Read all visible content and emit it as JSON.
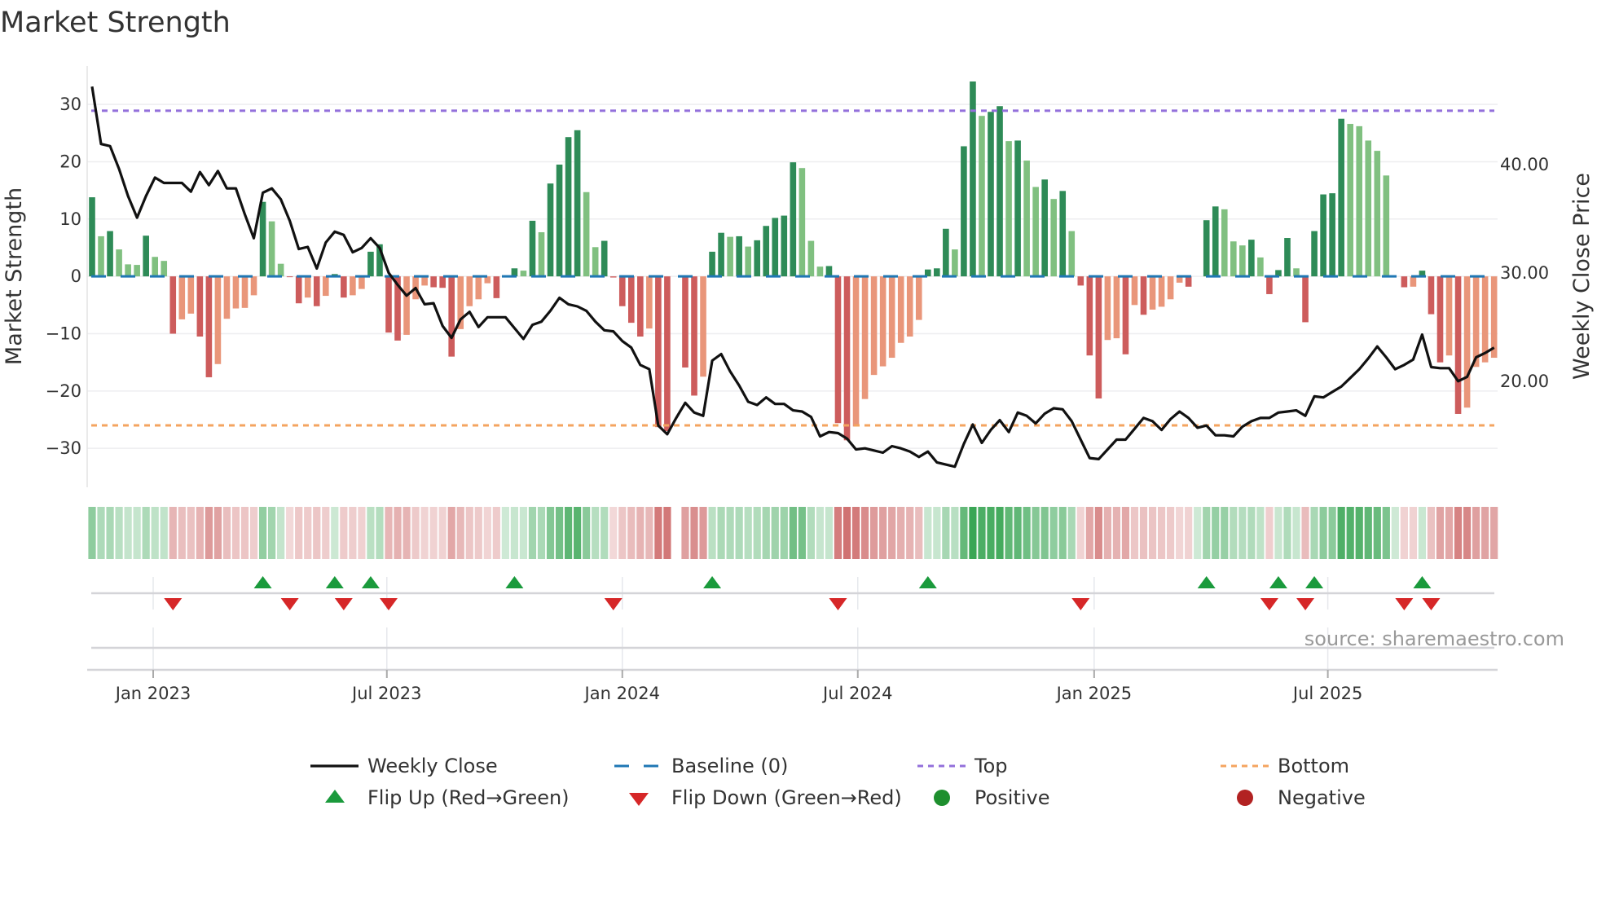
{
  "title": "Market Strength",
  "source": "source: sharemaestro.com",
  "colors": {
    "bar_pos_up": "#2e8b57",
    "bar_pos_down": "#80c080",
    "bar_neg_down": "#cd5c5c",
    "bar_neg_up": "#e9967a",
    "price": "#111111",
    "baseline": "#1f77b4",
    "top": "#9370db",
    "bottom": "#f4a460",
    "flip_up": "#1a9a3c",
    "flip_down": "#d62728",
    "positive": "#1e8f2e",
    "negative": "#b22222"
  },
  "chart_data": {
    "type": "bar+line",
    "title": "Market Strength",
    "ylabel": "Market Strength",
    "y2label": "Weekly Close Price",
    "ylim": [
      -36.8,
      36.7
    ],
    "y2lim": [
      10.2,
      49.1
    ],
    "yticks": [
      {
        "v": 30,
        "label": "30"
      },
      {
        "v": 20,
        "label": "20"
      },
      {
        "v": 10,
        "label": "10"
      },
      {
        "v": 0,
        "label": "0"
      },
      {
        "v": -10,
        "label": "−10"
      },
      {
        "v": -20,
        "label": "−20"
      },
      {
        "v": -30,
        "label": "−30"
      }
    ],
    "y2ticks": [
      {
        "v": 40,
        "label": "40.00"
      },
      {
        "v": 30,
        "label": "30.00"
      },
      {
        "v": 20,
        "label": "20.00"
      }
    ],
    "xticks": [
      {
        "week": 6.8,
        "label": "Jan 2023"
      },
      {
        "week": 32.8,
        "label": "Jul 2023"
      },
      {
        "week": 59.0,
        "label": "Jan 2024"
      },
      {
        "week": 85.2,
        "label": "Jul 2024"
      },
      {
        "week": 111.5,
        "label": "Jan 2025"
      },
      {
        "week": 137.5,
        "label": "Jul 2025"
      }
    ],
    "top": 28.9,
    "bottom": -26.0,
    "baseline": 0,
    "strength": [
      13.8,
      7,
      7.9,
      4.7,
      2.1,
      2,
      7.1,
      3.4,
      2.7,
      -10,
      -7.5,
      -6.5,
      -10.5,
      -17.6,
      -15.3,
      -7.4,
      -5.6,
      -5.5,
      -3.3,
      13,
      9.6,
      2.2,
      -0.1,
      -4.7,
      -3.7,
      -5.2,
      -3.4,
      0.4,
      -3.7,
      -3.3,
      -2.2,
      4.3,
      5.6,
      -9.8,
      -11.2,
      -10.2,
      -4,
      -1.6,
      -1.9,
      -2,
      -14,
      -9.2,
      -5.2,
      -4,
      -1.2,
      -3.8,
      0,
      1.4,
      1,
      9.7,
      7.7,
      16.2,
      19.5,
      24.3,
      25.5,
      14.7,
      5.1,
      6.2,
      -0.2,
      -5.2,
      -8.1,
      -10.5,
      -9.1,
      -26.3,
      -27,
      null,
      -15.9,
      -20.8,
      -17.5,
      4.3,
      7.6,
      6.9,
      7,
      5.2,
      6.3,
      8.8,
      10.2,
      10.6,
      19.9,
      18.9,
      6.2,
      1.7,
      1.8,
      -25.6,
      -28.6,
      -26.2,
      -21.4,
      -17.2,
      -15.7,
      -14.2,
      -11.6,
      -10.5,
      -7.6,
      1.2,
      1.4,
      8.3,
      4.7,
      22.7,
      34,
      28,
      28.7,
      29.7,
      23.6,
      23.7,
      20.2,
      15.6,
      16.9,
      13.5,
      14.9,
      7.9,
      -1.6,
      -13.8,
      -21.3,
      -11.1,
      -10.8,
      -13.6,
      -5,
      -6.7,
      -5.8,
      -5.3,
      -4,
      -1.1,
      -1.8,
      0,
      9.8,
      12.2,
      11.7,
      6.1,
      5.4,
      6.4,
      3.3,
      -3.1,
      1.1,
      6.7,
      1.4,
      -8,
      7.9,
      14.3,
      14.5,
      27.5,
      26.6,
      26.2,
      23.7,
      21.9,
      17.6,
      0,
      -1.9,
      -1.8,
      1,
      -6.6,
      -15,
      -13.8,
      -24,
      -22.9,
      -15.8,
      -15,
      -14.2
    ],
    "weekly_close": [
      47.2,
      41.9,
      41.7,
      39.6,
      37.1,
      35.1,
      37.1,
      38.8,
      38.3,
      38.3,
      38.3,
      37.5,
      39.3,
      38.1,
      39.4,
      37.8,
      37.8,
      35.4,
      33.2,
      37.4,
      37.8,
      36.8,
      34.8,
      32.2,
      32.4,
      30.4,
      32.8,
      33.8,
      33.5,
      31.9,
      32.3,
      33.2,
      32.3,
      30.0,
      28.9,
      27.9,
      28.6,
      27.1,
      27.2,
      25.1,
      24.0,
      25.7,
      26.4,
      25.0,
      25.9,
      25.9,
      25.9,
      24.9,
      23.9,
      25.2,
      25.5,
      26.5,
      27.7,
      27.1,
      26.9,
      26.5,
      25.5,
      24.7,
      24.6,
      23.7,
      23.1,
      21.5,
      21.1,
      15.9,
      15.1,
      16.6,
      18.0,
      17.1,
      16.8,
      21.9,
      22.5,
      20.9,
      19.6,
      18.1,
      17.8,
      18.5,
      17.9,
      17.9,
      17.3,
      17.2,
      16.7,
      14.9,
      15.3,
      15.2,
      14.7,
      13.7,
      13.8,
      13.6,
      13.4,
      14.0,
      13.8,
      13.5,
      13.0,
      13.5,
      12.5,
      12.3,
      12.1,
      14.2,
      16.0,
      14.3,
      15.5,
      16.4,
      15.3,
      17.1,
      16.8,
      16.1,
      17.0,
      17.5,
      17.4,
      16.3,
      14.6,
      12.9,
      12.8,
      13.7,
      14.6,
      14.6,
      15.6,
      16.6,
      16.3,
      15.5,
      16.5,
      17.2,
      16.6,
      15.7,
      15.9,
      15.0,
      15.0,
      14.9,
      15.8,
      16.3,
      16.6,
      16.6,
      17.1,
      17.2,
      17.3,
      16.8,
      18.6,
      18.5,
      19.0,
      19.5,
      20.3,
      21.1,
      22.1,
      23.2,
      22.2,
      21.1,
      21.5,
      22.0,
      24.3,
      21.3,
      21.2,
      21.2,
      20.0,
      20.4,
      22.2,
      22.6,
      23.1
    ],
    "flip_up_weeks": [
      19,
      27,
      31,
      47,
      69,
      93,
      124,
      132,
      136,
      148
    ],
    "flip_down_weeks": [
      9,
      22,
      28,
      33,
      58,
      83,
      110,
      131,
      135,
      146,
      149
    ],
    "legend_position": "bottom",
    "legend": [
      {
        "key": "line",
        "label": "Weekly Close"
      },
      {
        "key": "baseline",
        "label": "Baseline (0)"
      },
      {
        "key": "top",
        "label": "Top"
      },
      {
        "key": "bottom",
        "label": "Bottom"
      },
      {
        "key": "flipup",
        "label": "Flip Up (Red→Green)"
      },
      {
        "key": "flipdown",
        "label": "Flip Down (Green→Red)"
      },
      {
        "key": "positive",
        "label": "Positive"
      },
      {
        "key": "negative",
        "label": "Negative"
      }
    ]
  }
}
